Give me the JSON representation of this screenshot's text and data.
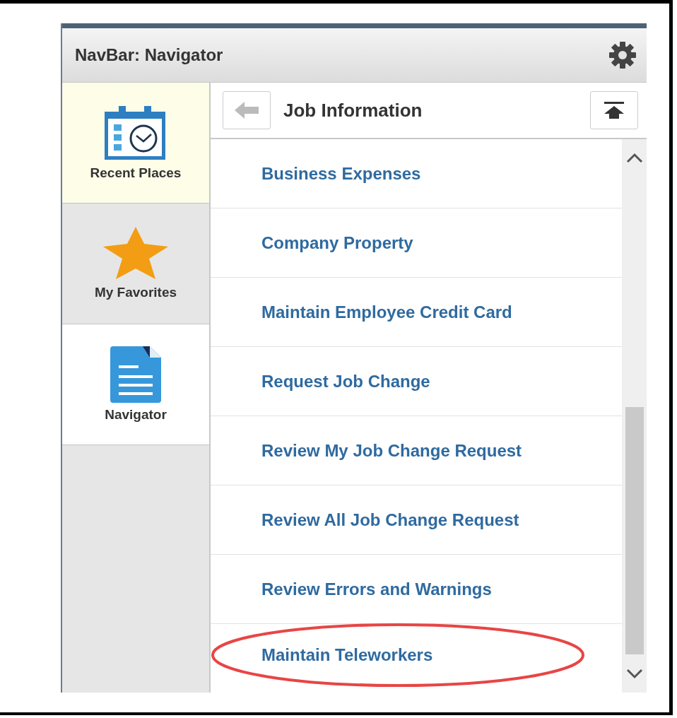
{
  "header": {
    "title": "NavBar: Navigator"
  },
  "sidebar": {
    "items": [
      {
        "label": "Recent Places",
        "kind": "recent",
        "selected": false,
        "highlighted": true
      },
      {
        "label": "My Favorites",
        "kind": "favorites",
        "selected": false,
        "highlighted": false
      },
      {
        "label": "Navigator",
        "kind": "navigator",
        "selected": true,
        "highlighted": false
      }
    ]
  },
  "content": {
    "title": "Job Information",
    "items": [
      {
        "label": "Business Expenses",
        "circled": false
      },
      {
        "label": "Company Property",
        "circled": false
      },
      {
        "label": "Maintain Employee Credit Card",
        "circled": false
      },
      {
        "label": "Request Job Change",
        "circled": false
      },
      {
        "label": "Review My Job Change Request",
        "circled": false
      },
      {
        "label": "Review All Job Change Request",
        "circled": false
      },
      {
        "label": "Review Errors and Warnings",
        "circled": false
      },
      {
        "label": "Maintain Teleworkers",
        "circled": true
      }
    ]
  }
}
